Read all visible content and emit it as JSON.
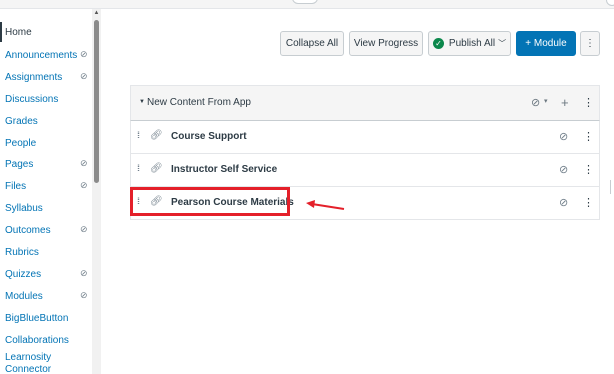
{
  "sidebar": {
    "items": [
      {
        "label": "Home",
        "active": true,
        "hidden": false
      },
      {
        "label": "Announcements",
        "hidden": true
      },
      {
        "label": "Assignments",
        "hidden": true
      },
      {
        "label": "Discussions",
        "hidden": false
      },
      {
        "label": "Grades",
        "hidden": false
      },
      {
        "label": "People",
        "hidden": false
      },
      {
        "label": "Pages",
        "hidden": true
      },
      {
        "label": "Files",
        "hidden": true
      },
      {
        "label": "Syllabus",
        "hidden": false
      },
      {
        "label": "Outcomes",
        "hidden": true
      },
      {
        "label": "Rubrics",
        "hidden": false
      },
      {
        "label": "Quizzes",
        "hidden": true
      },
      {
        "label": "Modules",
        "hidden": true
      },
      {
        "label": "BigBlueButton",
        "hidden": false
      },
      {
        "label": "Collaborations",
        "hidden": false
      },
      {
        "label": "Learnosity Connector",
        "hidden": false
      }
    ],
    "hidden_icon": "eye-slash-icon"
  },
  "toolbar": {
    "collapse_all": "Collapse All",
    "view_progress": "View Progress",
    "publish_all": "Publish All",
    "add_module": "+ Module",
    "more_icon": "kebab-icon"
  },
  "module": {
    "title": "New Content From App",
    "items": [
      {
        "title": "Course Support",
        "highlighted": false
      },
      {
        "title": "Instructor Self Service",
        "highlighted": false
      },
      {
        "title": "Pearson Course Materials",
        "highlighted": true
      }
    ]
  },
  "colors": {
    "link": "#0374b5",
    "primary": "#0374b5",
    "published": "#0b874b",
    "annotation": "#e4202a"
  }
}
